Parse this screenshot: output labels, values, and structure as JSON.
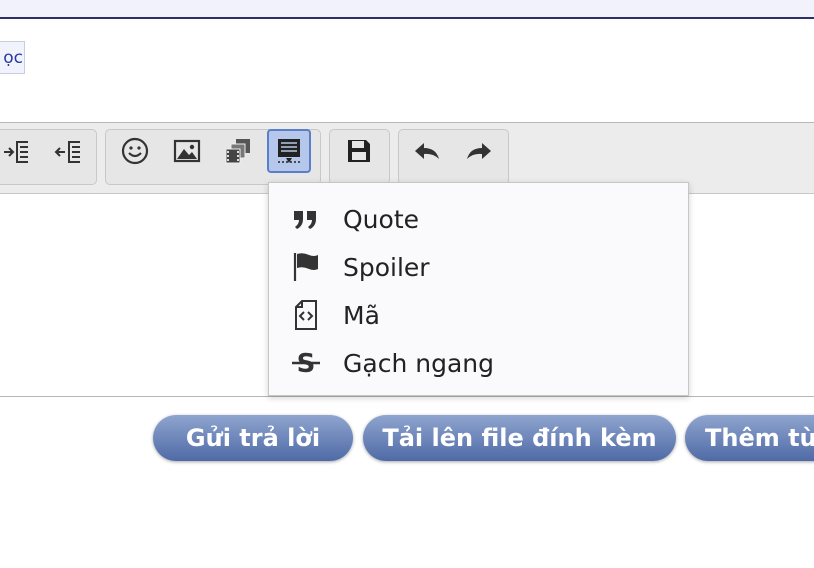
{
  "tag": {
    "label": "ọc"
  },
  "toolbar": {
    "buttons": [
      {
        "icon": "outdent-icon"
      },
      {
        "icon": "indent-icon"
      },
      {
        "icon": "smiley-icon"
      },
      {
        "icon": "image-icon"
      },
      {
        "icon": "media-icon"
      },
      {
        "icon": "insert-block-icon"
      },
      {
        "icon": "save-draft-icon"
      },
      {
        "icon": "undo-icon"
      },
      {
        "icon": "redo-icon"
      }
    ]
  },
  "dropdown": {
    "items": [
      {
        "label": "Quote",
        "icon": "quote-icon"
      },
      {
        "label": "Spoiler",
        "icon": "flag-icon"
      },
      {
        "label": "Mã",
        "icon": "code-file-icon"
      },
      {
        "label": "Gạch ngang",
        "icon": "strikethrough-icon"
      }
    ]
  },
  "actions": {
    "reply": "Gửi trả lời",
    "upload": "Tải lên file đính kèm",
    "more": "Thêm từ"
  },
  "colors": {
    "accent": "#5a7ec8",
    "button": "#5b74ad",
    "header_line": "#2c2f68"
  }
}
